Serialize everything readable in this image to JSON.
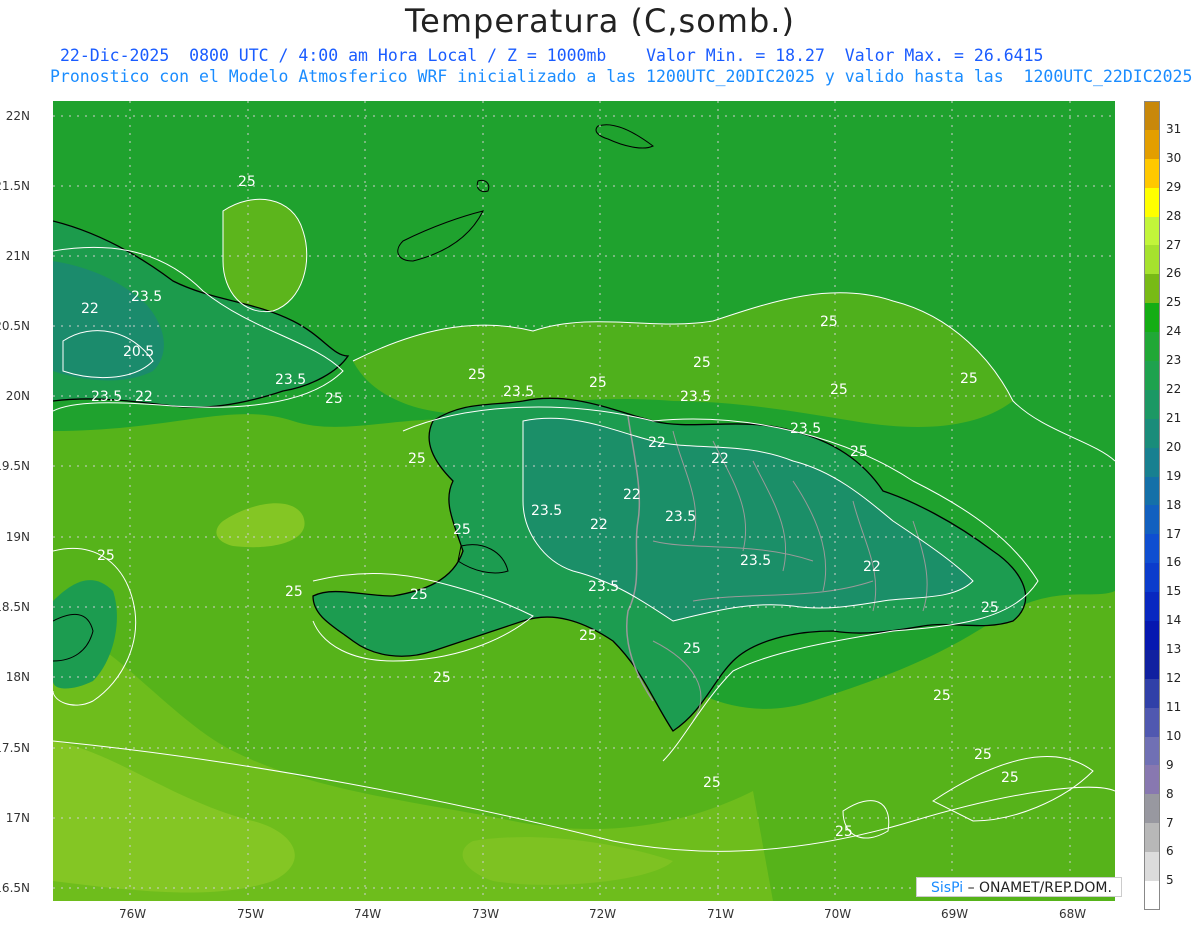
{
  "title": "Temperatura (C,somb.)",
  "subtitle_line1": "22-Dic-2025  0800 UTC / 4:00 am Hora Local / Z = 1000mb    Valor Min. = 18.27  Valor Max. = 26.6415",
  "subtitle_line2": "Pronostico con el Modelo Atmosferico WRF inicializado a las 1200UTC_20DIC2025 y valido hasta las  1200UTC_22DIC2025",
  "map": {
    "lat_labels": [
      "22N",
      "21.5N",
      "21N",
      "20.5N",
      "20N",
      "19.5N",
      "19N",
      "18.5N",
      "18N",
      "17.5N",
      "17N",
      "16.5N"
    ],
    "lon_labels": [
      "76W",
      "75W",
      "74W",
      "73W",
      "72W",
      "71W",
      "70W",
      "69W",
      "68W"
    ],
    "contour_labels": [
      "25",
      "23.5",
      "22",
      "20.5",
      "23.5",
      "22",
      "23.5",
      "25",
      "25",
      "25",
      "23.5",
      "25",
      "23.5",
      "25",
      "25",
      "25",
      "22",
      "22",
      "22",
      "23.5",
      "23.5",
      "22",
      "23.5",
      "22",
      "23.5",
      "23.5",
      "25",
      "25",
      "25",
      "25",
      "25",
      "25",
      "25",
      "25",
      "25",
      "25",
      "25",
      "25",
      "25",
      "25"
    ],
    "colors": {
      "sea_green": "#48b51c",
      "land_dark": "#1fa23e",
      "land_mid": "#21a35a",
      "land_teal": "#1c9370",
      "light_green": "#8ecd20",
      "border": "#000000",
      "province": "#a0a0a0",
      "contour": "#ffffff",
      "grid": "#bbbbbb"
    }
  },
  "colorbar": {
    "labels": [
      "31",
      "30",
      "29",
      "28",
      "27",
      "26",
      "25",
      "24",
      "23",
      "22",
      "21",
      "20",
      "19",
      "18",
      "17",
      "16",
      "15",
      "14",
      "13",
      "12",
      "11",
      "10",
      "9",
      "8",
      "7",
      "6",
      "5"
    ],
    "colors": [
      "#c8880a",
      "#e39e00",
      "#ffc800",
      "#ffff00",
      "#c2f53a",
      "#a6e22e",
      "#78ba16",
      "#14ad14",
      "#20a836",
      "#1ea24e",
      "#1c9864",
      "#1a8c7a",
      "#188090",
      "#1470a8",
      "#1260bf",
      "#0f4ed0",
      "#0b3ccc",
      "#0828c0",
      "#0618b0",
      "#1020a0",
      "#3040a8",
      "#5058b0",
      "#7070b4",
      "#8878b0",
      "#9898a0",
      "#b8b8b8",
      "#dcdcdc",
      "#ffffff"
    ]
  },
  "credit": {
    "brand": "SisPi",
    "text": "– ONAMET/REP.DOM."
  }
}
